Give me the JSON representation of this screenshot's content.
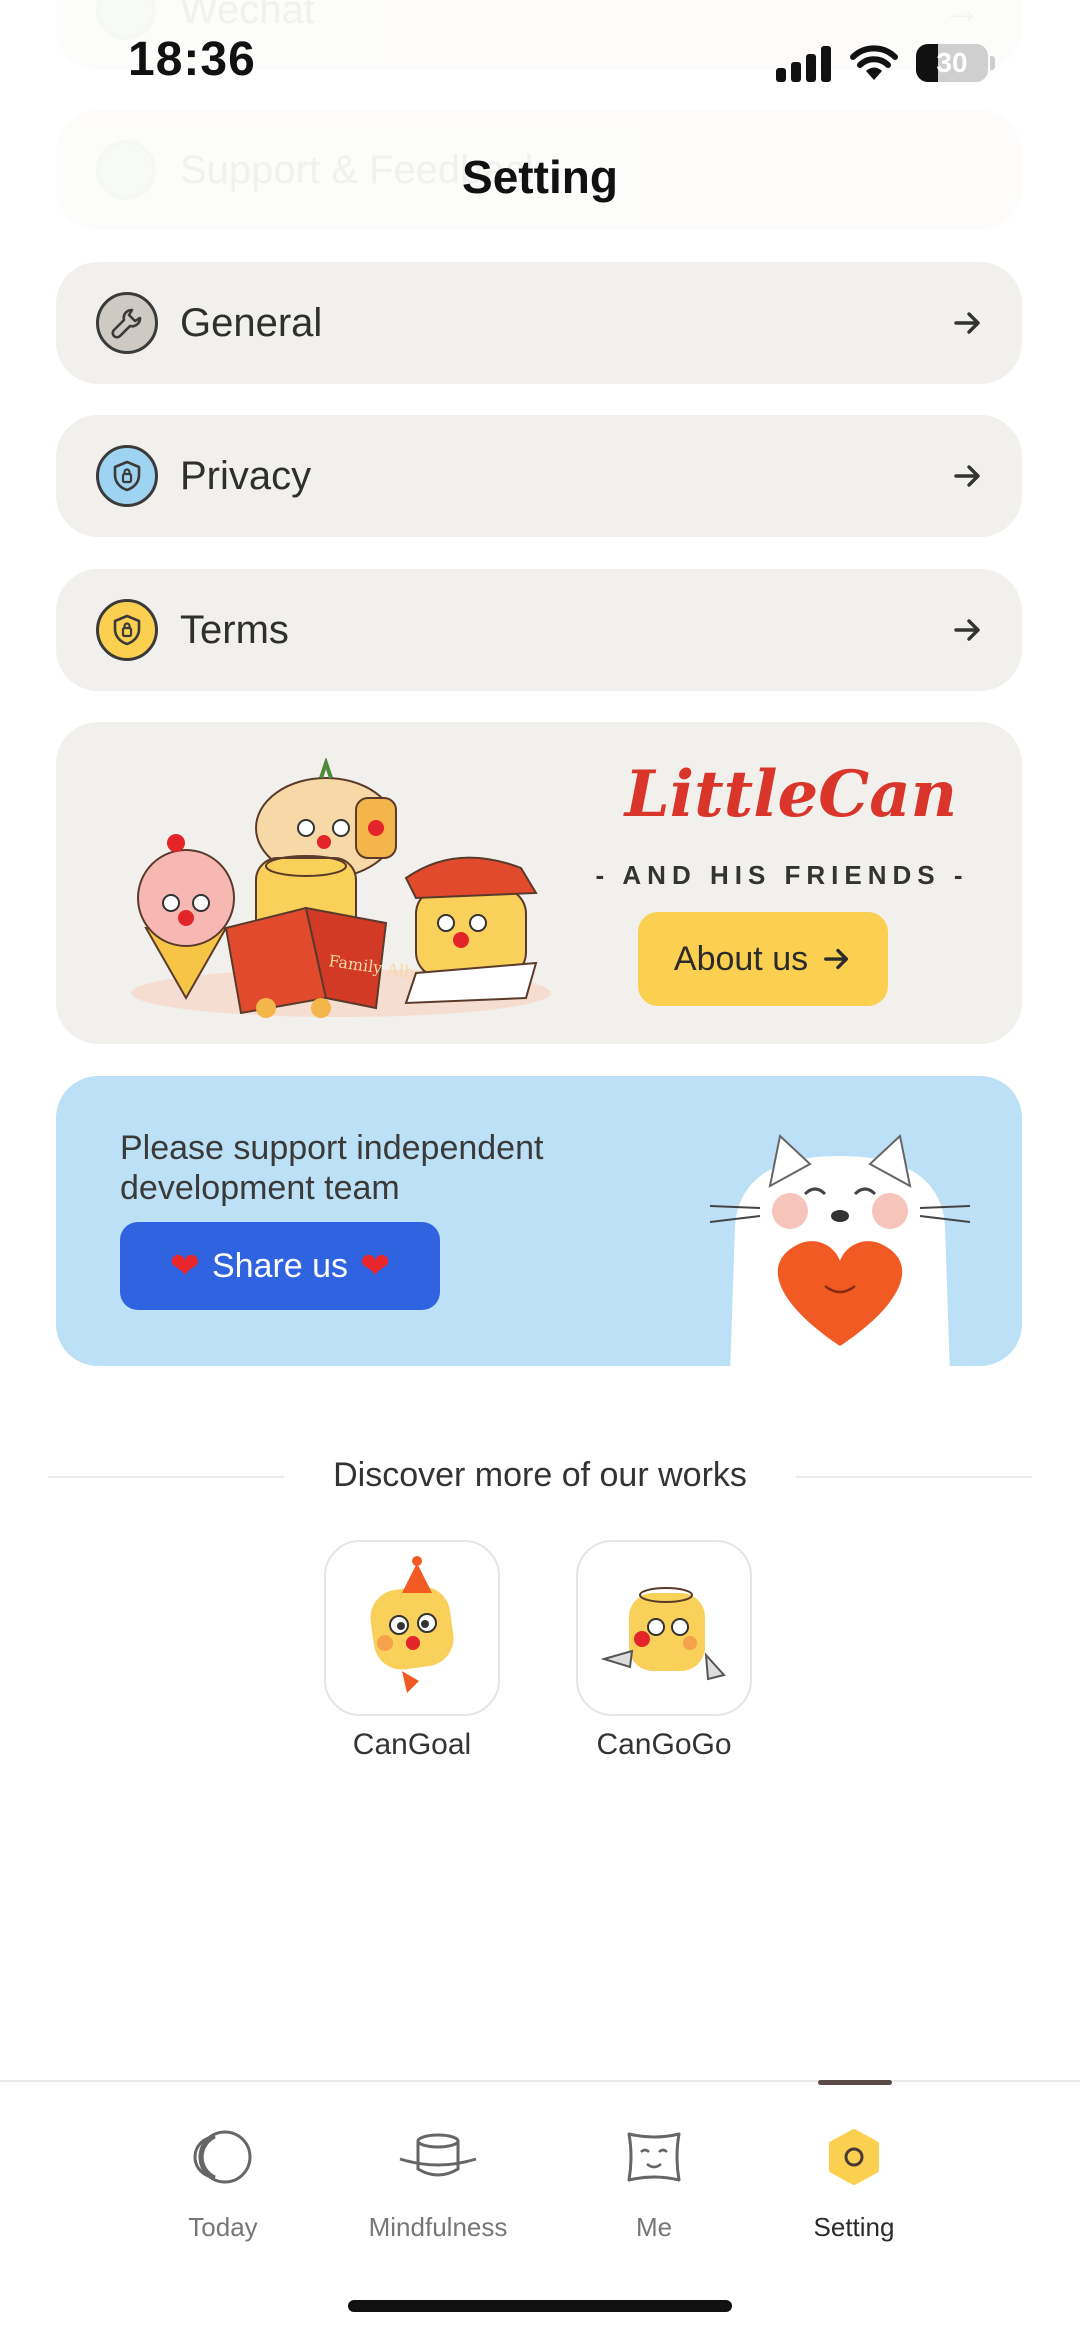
{
  "status_bar": {
    "time": "18:36",
    "battery": "30"
  },
  "ghost_rows": [
    "Wechat",
    "Support & Feedback"
  ],
  "header": {
    "title": "Setting"
  },
  "settings": [
    {
      "label": "General",
      "icon": "wrench-icon",
      "color": "#cfc9c4"
    },
    {
      "label": "Privacy",
      "icon": "shield-lock-icon",
      "color": "#9fd3f2"
    },
    {
      "label": "Terms",
      "icon": "shield-lock-icon",
      "color": "#fbcf4f"
    }
  ],
  "brand_banner": {
    "logo_text": "LittleCan",
    "subtitle": "- AND HIS FRIENDS -",
    "book_text": "Family Album",
    "button_label": "About us"
  },
  "share_banner": {
    "text": "Please support independent development team",
    "button_label": "Share us"
  },
  "discover": {
    "title": "Discover more of our works",
    "apps": [
      {
        "name": "CanGoal"
      },
      {
        "name": "CanGoGo"
      }
    ]
  },
  "tabbar": {
    "tabs": [
      {
        "label": "Today",
        "icon": "moon-circle-icon"
      },
      {
        "label": "Mindfulness",
        "icon": "pot-icon"
      },
      {
        "label": "Me",
        "icon": "face-box-icon"
      },
      {
        "label": "Setting",
        "icon": "hexagon-icon",
        "active": true
      }
    ]
  },
  "colors": {
    "accent_yellow": "#fbcf4f",
    "share_blue": "#2f63e0",
    "share_bg": "#bce0f5",
    "row_bg": "#f2f0ec",
    "brand_red": "#d9352a"
  }
}
